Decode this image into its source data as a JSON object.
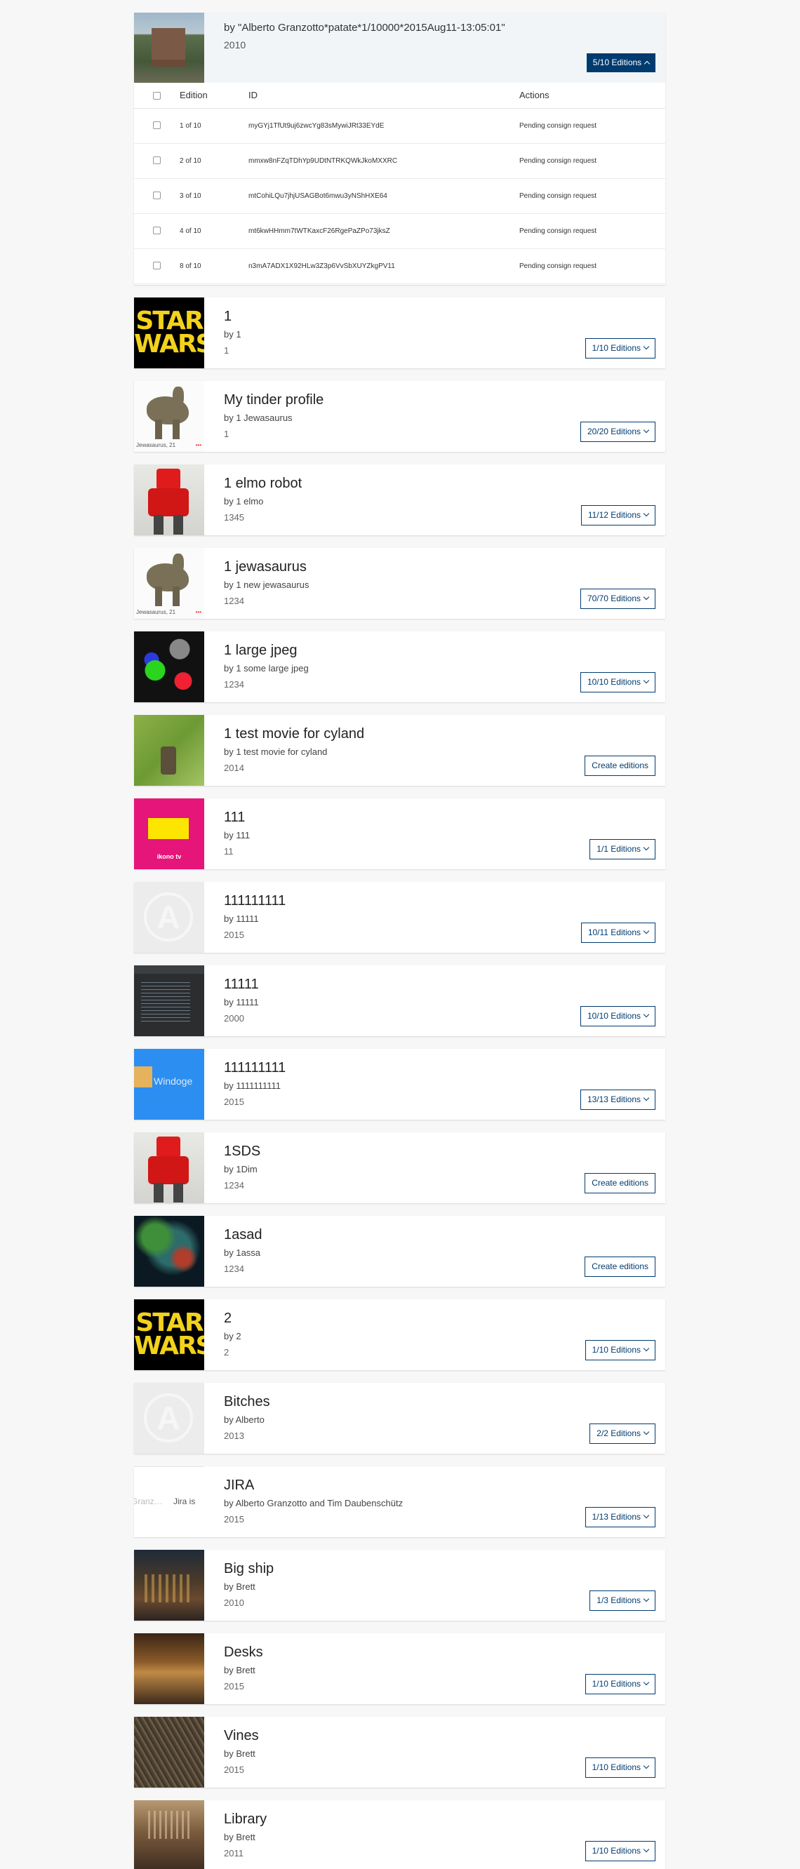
{
  "expanded_piece": {
    "by_line": "by \"Alberto Granzotto*patate*1/10000*2015Aug11-13:05:01\"",
    "year": "2010",
    "editions_button": "5/10 Editions",
    "table": {
      "headers": {
        "edition": "Edition",
        "id": "ID",
        "actions": "Actions"
      },
      "rows": [
        {
          "edition": "1 of 10",
          "id": "myGYj1TfUt9uj6zwcYg83sMywiJRt33EYdE",
          "action": "Pending consign request"
        },
        {
          "edition": "2 of 10",
          "id": "mmxw8nFZqTDhYp9UDtNTRKQWkJkoMXXRC",
          "action": "Pending consign request"
        },
        {
          "edition": "3 of 10",
          "id": "mtCohiLQu7jhjUSAGBot6mwu3yNShHXE64",
          "action": "Pending consign request"
        },
        {
          "edition": "4 of 10",
          "id": "mt6kwHHmm7tWTKaxcF26RgePaZPo73jksZ",
          "action": "Pending consign request"
        },
        {
          "edition": "8 of 10",
          "id": "n3mA7ADX1X92HLw3Z3p6VvSbXUYZkgPV11",
          "action": "Pending consign request"
        }
      ]
    }
  },
  "pieces": [
    {
      "thumb": "star",
      "title": "1",
      "by": "by 1",
      "year": "1",
      "button": "1/10 Editions",
      "chevron": true
    },
    {
      "thumb": "dino",
      "thumb_caption": "Jewasaurus, 21",
      "title": "My tinder profile",
      "by": "by 1 Jewasaurus",
      "year": "1",
      "button": "20/20 Editions",
      "chevron": true
    },
    {
      "thumb": "robot",
      "title": "1 elmo robot",
      "by": "by 1 elmo",
      "year": "1345",
      "button": "11/12 Editions",
      "chevron": true
    },
    {
      "thumb": "dino",
      "thumb_caption": "Jewasaurus, 21",
      "title": "1 jewasaurus",
      "by": "by 1 new jewasaurus",
      "year": "1234",
      "button": "70/70 Editions",
      "chevron": true
    },
    {
      "thumb": "jpeg",
      "title": "1 large jpeg",
      "by": "by 1 some large jpeg",
      "year": "1234",
      "button": "10/10 Editions",
      "chevron": true
    },
    {
      "thumb": "grass",
      "title": "1 test movie for cyland",
      "by": "by 1 test movie for cyland",
      "year": "2014",
      "button": "Create editions",
      "chevron": false
    },
    {
      "thumb": "ikono",
      "thumb_caption": "ikono tv",
      "title": "111",
      "by": "by 111",
      "year": "11",
      "button": "1/1 Editions",
      "chevron": true
    },
    {
      "thumb": "anarchy",
      "title": "111111111",
      "by": "by 11111",
      "year": "2015",
      "button": "10/11 Editions",
      "chevron": true
    },
    {
      "thumb": "code",
      "title": "11111",
      "by": "by 11111",
      "year": "2000",
      "button": "10/10 Editions",
      "chevron": true
    },
    {
      "thumb": "win",
      "thumb_caption": "Windoge",
      "title": "111111111",
      "by": "by 1111111111",
      "year": "2015",
      "button": "13/13 Editions",
      "chevron": true
    },
    {
      "thumb": "robot",
      "title": "1SDS",
      "by": "by 1Dim",
      "year": "1234",
      "button": "Create editions",
      "chevron": false
    },
    {
      "thumb": "space",
      "title": "1asad",
      "by": "by 1assa",
      "year": "1234",
      "button": "Create editions",
      "chevron": false
    },
    {
      "thumb": "star",
      "title": "2",
      "by": "by 2",
      "year": "2",
      "button": "1/10 Editions",
      "chevron": true
    },
    {
      "thumb": "anarchy",
      "title": "Bitches",
      "by": "by Alberto",
      "year": "2013",
      "button": "2/2 Editions",
      "chevron": true
    },
    {
      "thumb": "jira",
      "thumb_caption": "Jira is",
      "title": "JIRA",
      "by": "by Alberto Granzotto and Tim Daubenschütz",
      "year": "2015",
      "button": "1/13 Editions",
      "chevron": true
    },
    {
      "thumb": "ship",
      "title": "Big ship",
      "by": "by Brett",
      "year": "2010",
      "button": "1/3 Editions",
      "chevron": true
    },
    {
      "thumb": "desks",
      "title": "Desks",
      "by": "by Brett",
      "year": "2015",
      "button": "1/10 Editions",
      "chevron": true
    },
    {
      "thumb": "vines",
      "title": "Vines",
      "by": "by Brett",
      "year": "2015",
      "button": "1/10 Editions",
      "chevron": true
    },
    {
      "thumb": "lib",
      "title": "Library",
      "by": "by Brett",
      "year": "2011",
      "button": "1/10 Editions",
      "chevron": true
    }
  ],
  "star_text": "STAR WARS",
  "colors": {
    "accent": "#003b6f",
    "header_bg": "#f1f5f8",
    "page_bg": "#f7f7f7"
  }
}
